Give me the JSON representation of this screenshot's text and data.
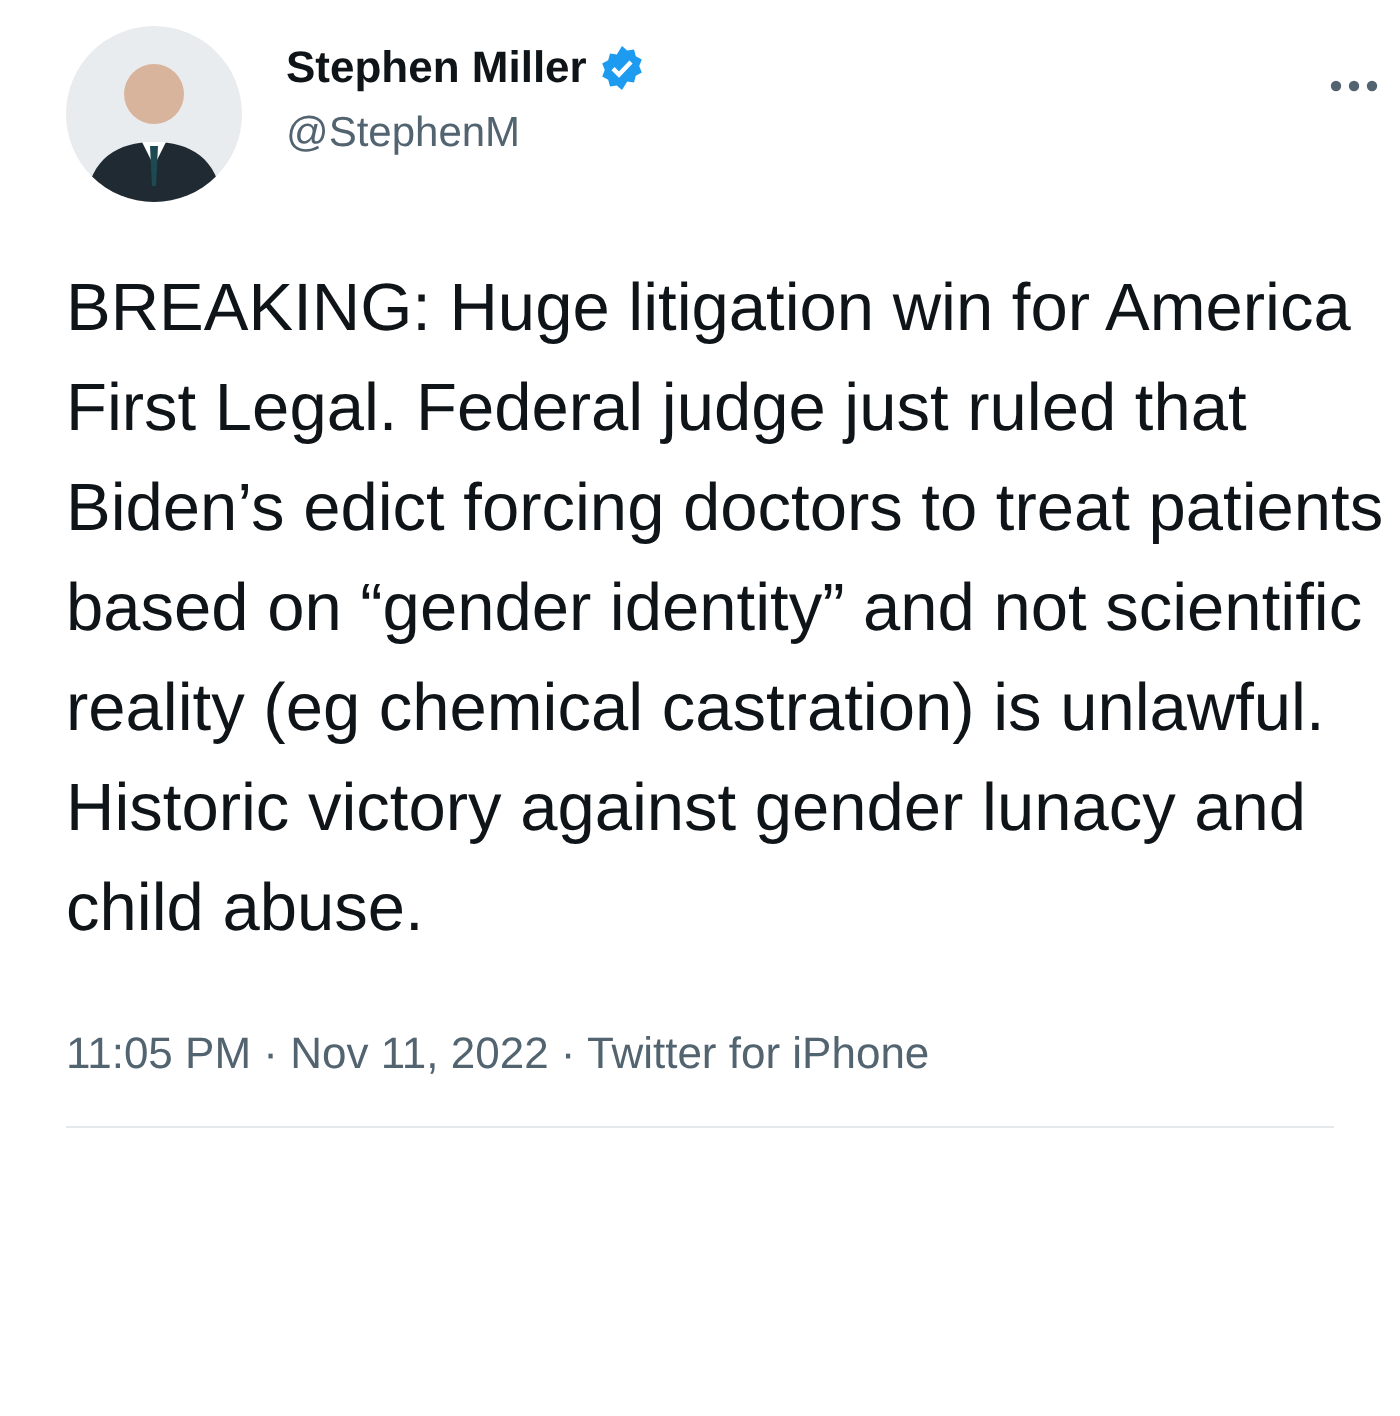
{
  "author": {
    "name": "Stephen Miller",
    "handle": "@StephenM",
    "verified": true
  },
  "tweet": {
    "text": "BREAKING: Huge litigation win for America First Legal. Federal judge just ruled that Biden’s edict forcing doctors to treat patients based on “gender identity” and not scientific reality (eg chemical castration) is unlawful. Historic victory against gender lunacy and child abuse.",
    "meta": "11:05 PM · Nov 11, 2022 · Twitter for iPhone"
  }
}
